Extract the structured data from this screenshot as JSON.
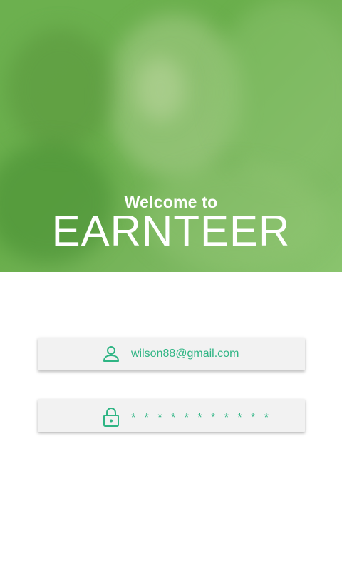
{
  "header": {
    "welcome_text": "Welcome to",
    "brand_name": "EARNTEER"
  },
  "login": {
    "email": {
      "value": "wilson88@gmail.com",
      "icon": "user-icon"
    },
    "password": {
      "value": "***********",
      "icon": "lock-icon"
    }
  },
  "colors": {
    "hero_green": "#6aaf4c",
    "accent_teal": "#2fb584",
    "field_background": "#f2f2f2"
  }
}
